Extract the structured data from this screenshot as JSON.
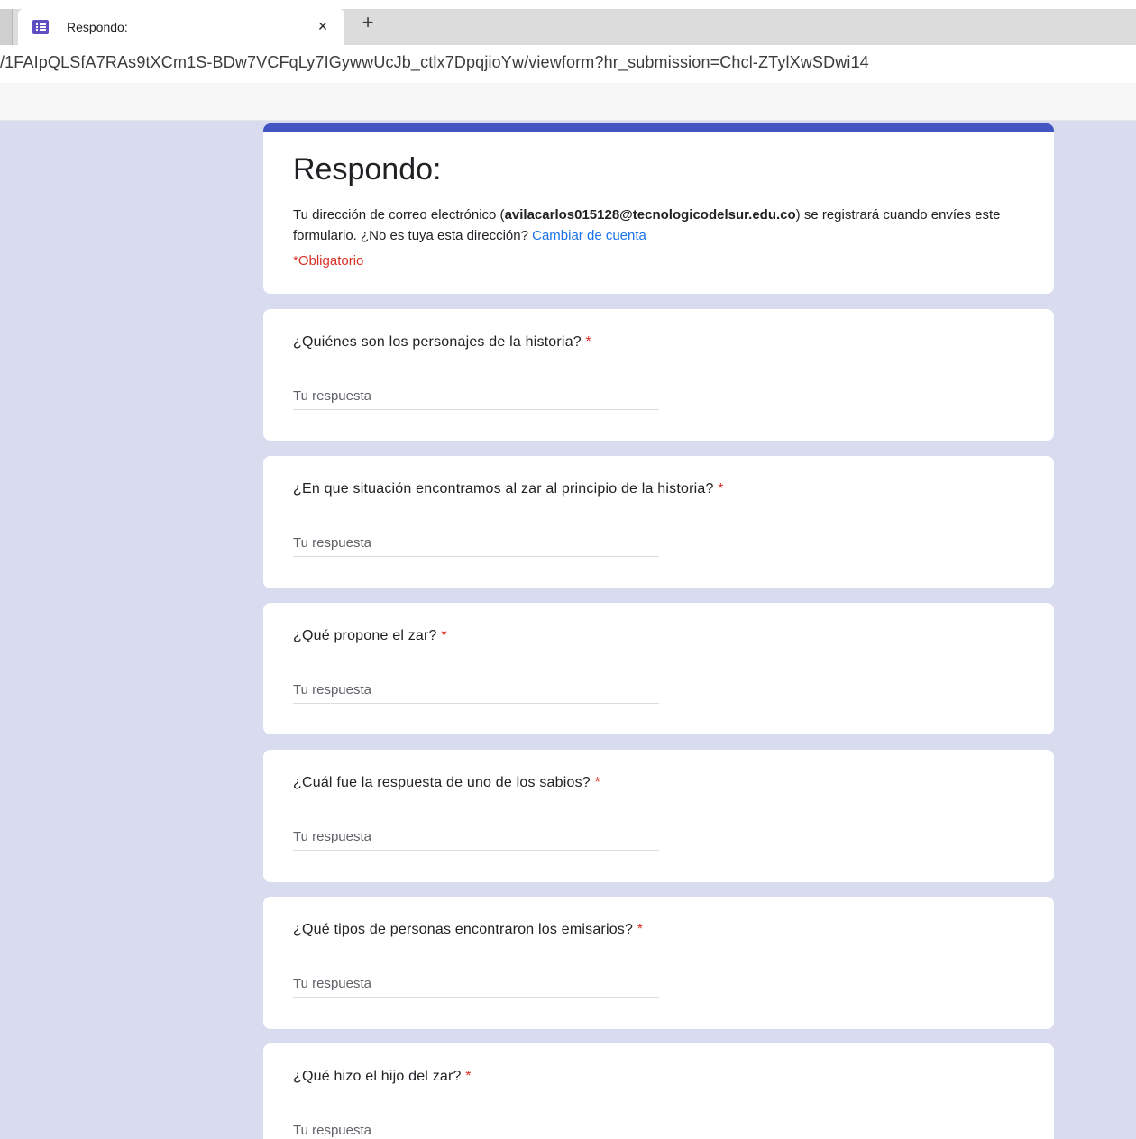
{
  "browser": {
    "tab_title": "Respondo:",
    "close_glyph": "×",
    "new_tab_glyph": "+",
    "url": "/1FAIpQLSfA7RAs9tXCm1S-BDw7VCFqLy7IGywwUcJb_ctlx7DpqjioYw/viewform?hr_submission=Chcl-ZTylXwSDwi14",
    "favicon_icon": "forms-list-icon"
  },
  "form": {
    "title": "Respondo:",
    "desc_prefix": "Tu dirección de correo electrónico (",
    "email": "avilacarlos015128@tecnologicodelsur.edu.co",
    "desc_suffix": ") se registrará cuando envíes este formulario. ¿No es tuya esta dirección? ",
    "switch_account_link": "Cambiar de cuenta",
    "required_note": "*Obligatorio",
    "required_star": "*",
    "answer_placeholder": "Tu respuesta",
    "questions": [
      {
        "label": "¿Quiénes son los personajes de la historia?"
      },
      {
        "label": "¿En que situación encontramos al zar al principio de la historia?"
      },
      {
        "label": "¿Qué propone el zar?"
      },
      {
        "label": "¿Cuál fue la respuesta de uno de los sabios?"
      },
      {
        "label": "¿Qué tipos de personas encontraron los emisarios?"
      },
      {
        "label": "¿Qué hizo el hijo del zar?"
      }
    ]
  },
  "colors": {
    "theme_accent": "#4355c2",
    "page_background": "#d9dcef",
    "required_red": "#d93025",
    "link_blue": "#1a73e8"
  }
}
